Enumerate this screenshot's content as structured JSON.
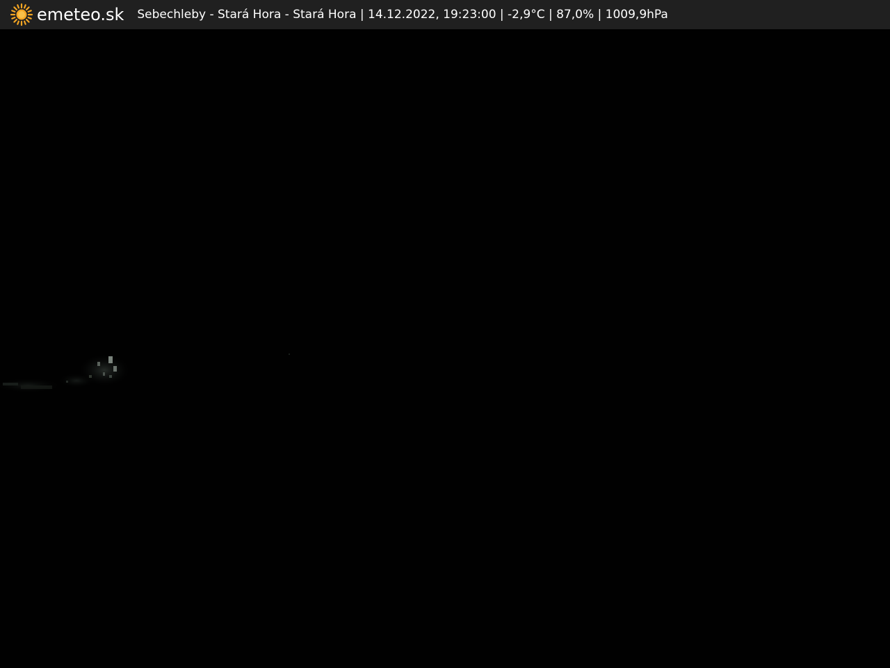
{
  "overlay": {
    "logo_icon": "sun-icon",
    "brand": "emeteo.sk",
    "caption": "Sebechleby - Stará Hora - Stará Hora | 14.12.2022, 19:23:00 | -2,9°C | 87,0% | 1009,9hPa"
  },
  "colors": {
    "bar_background": "#202020",
    "sun": "#f5a623",
    "image_background": "#010101"
  }
}
